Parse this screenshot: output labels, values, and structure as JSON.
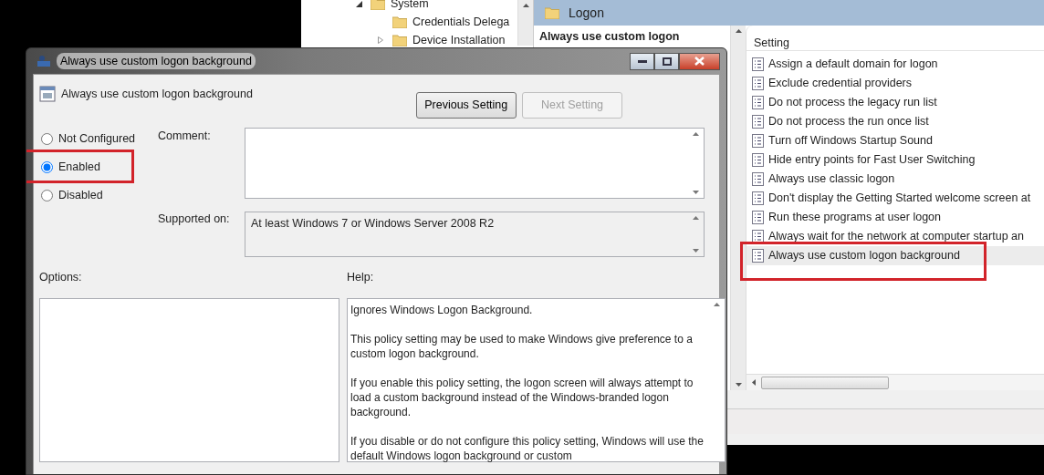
{
  "editor": {
    "tree": [
      {
        "label": "System",
        "expanded": true,
        "children": [
          {
            "label": "Credentials Delega"
          },
          {
            "label": "Device Installation",
            "expanded": false
          }
        ]
      }
    ],
    "header": {
      "title": "Logon"
    },
    "detail": {
      "title": "Always use custom logon"
    },
    "settings": {
      "column": "Setting",
      "items": [
        {
          "label": "Assign a default domain for logon",
          "selected": false,
          "annotated": false
        },
        {
          "label": "Exclude credential providers",
          "selected": false,
          "annotated": false
        },
        {
          "label": "Do not process the legacy run list",
          "selected": false,
          "annotated": false
        },
        {
          "label": "Do not process the run once list",
          "selected": false,
          "annotated": false
        },
        {
          "label": "Turn off Windows Startup Sound",
          "selected": false,
          "annotated": false
        },
        {
          "label": "Hide entry points for Fast User Switching",
          "selected": false,
          "annotated": false
        },
        {
          "label": "Always use classic logon",
          "selected": false,
          "annotated": false
        },
        {
          "label": "Don't display the Getting Started welcome screen at",
          "selected": false,
          "annotated": false
        },
        {
          "label": "Run these programs at user logon",
          "selected": false,
          "annotated": false
        },
        {
          "label": "Always wait for the network at computer startup an",
          "selected": false,
          "annotated": false
        },
        {
          "label": "Always use custom logon background",
          "selected": true,
          "annotated": true
        }
      ]
    }
  },
  "dialog": {
    "title": "Always use custom logon background",
    "heading": "Always use custom logon background",
    "buttons": [
      {
        "label": "Previous Setting",
        "disabled": false
      },
      {
        "label": "Next Setting",
        "disabled": true
      }
    ],
    "states": [
      {
        "label": "Not Configured",
        "selected": false,
        "annotated": false
      },
      {
        "label": "Enabled",
        "selected": true,
        "annotated": true
      },
      {
        "label": "Disabled",
        "selected": false,
        "annotated": false
      }
    ],
    "comment": {
      "label": "Comment:"
    },
    "supported_on": {
      "label": "Supported on:",
      "value": "At least Windows 7 or Windows Server 2008 R2"
    },
    "options": {
      "label": "Options:"
    },
    "help": {
      "label": "Help:",
      "paragraphs": [
        "Ignores Windows Logon Background.",
        "This policy setting may be used to make Windows give preference to a custom logon background.",
        "If you enable this policy setting, the logon screen will always attempt to load a custom background instead of the Windows-branded logon background.",
        "If you disable or do not configure this policy setting, Windows will use the default Windows logon background or custom"
      ]
    }
  }
}
